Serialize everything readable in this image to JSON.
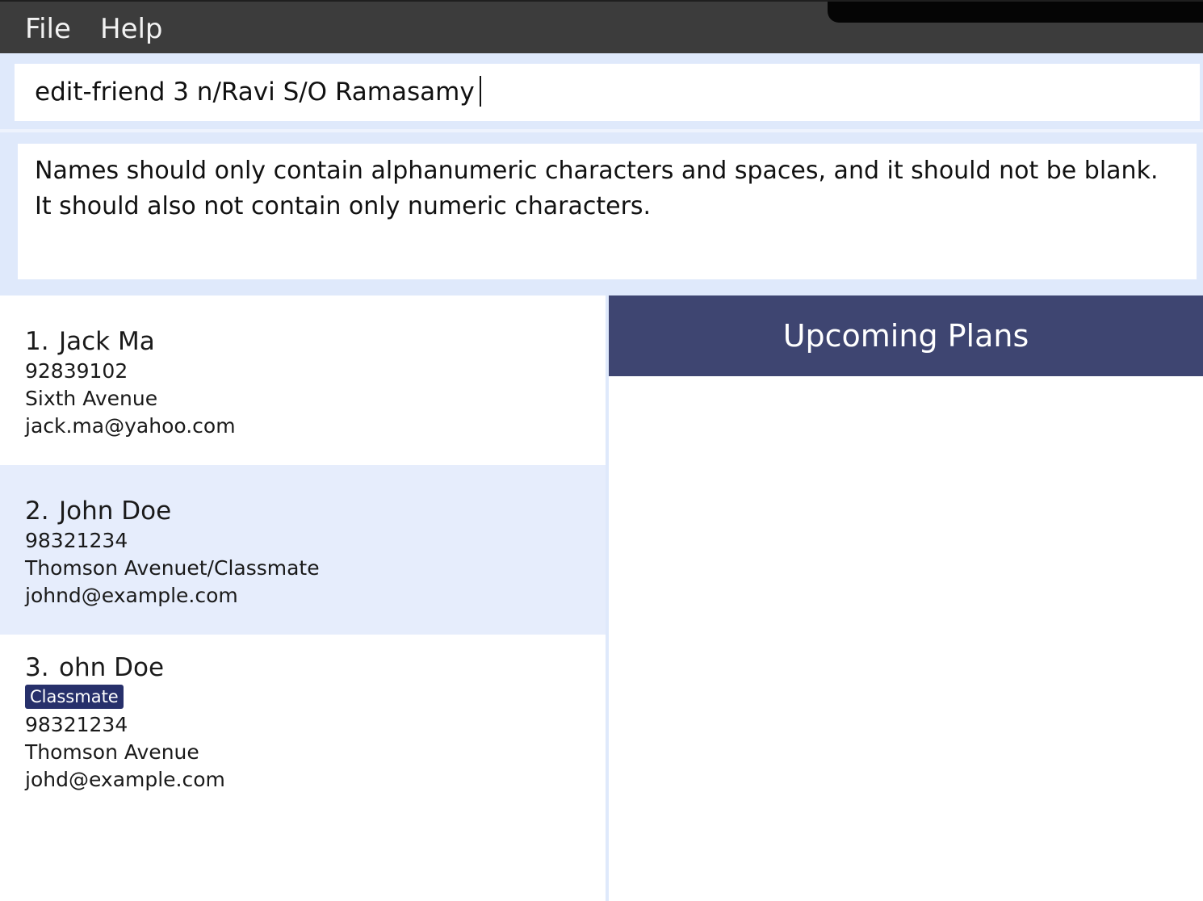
{
  "menu": {
    "file_label": "File",
    "help_label": "Help"
  },
  "command": {
    "value": "edit-friend 3 n/Ravi S/O Ramasamy"
  },
  "result": {
    "line1": "Names should only contain alphanumeric characters and spaces, and it should not be blank.",
    "line2": "It should also not contain only numeric characters."
  },
  "persons": [
    {
      "index": "1.",
      "name": "Jack Ma",
      "phone": "92839102",
      "address": "Sixth Avenue",
      "email": "jack.ma@yahoo.com"
    },
    {
      "index": "2.",
      "name": "John Doe",
      "phone": "98321234",
      "address": "Thomson Avenuet/Classmate",
      "email": "johnd@example.com"
    },
    {
      "index": "3.",
      "name": "ohn Doe",
      "tag": "Classmate",
      "phone": "98321234",
      "address": "Thomson Avenue",
      "email": "johd@example.com"
    }
  ],
  "plans": {
    "title": "Upcoming Plans"
  },
  "colors": {
    "menubar": "#3c3c3c",
    "background": "#dfe9fb",
    "selected_card": "#e6edfc",
    "tag": "#27306b",
    "plans_header": "#3e4571"
  }
}
